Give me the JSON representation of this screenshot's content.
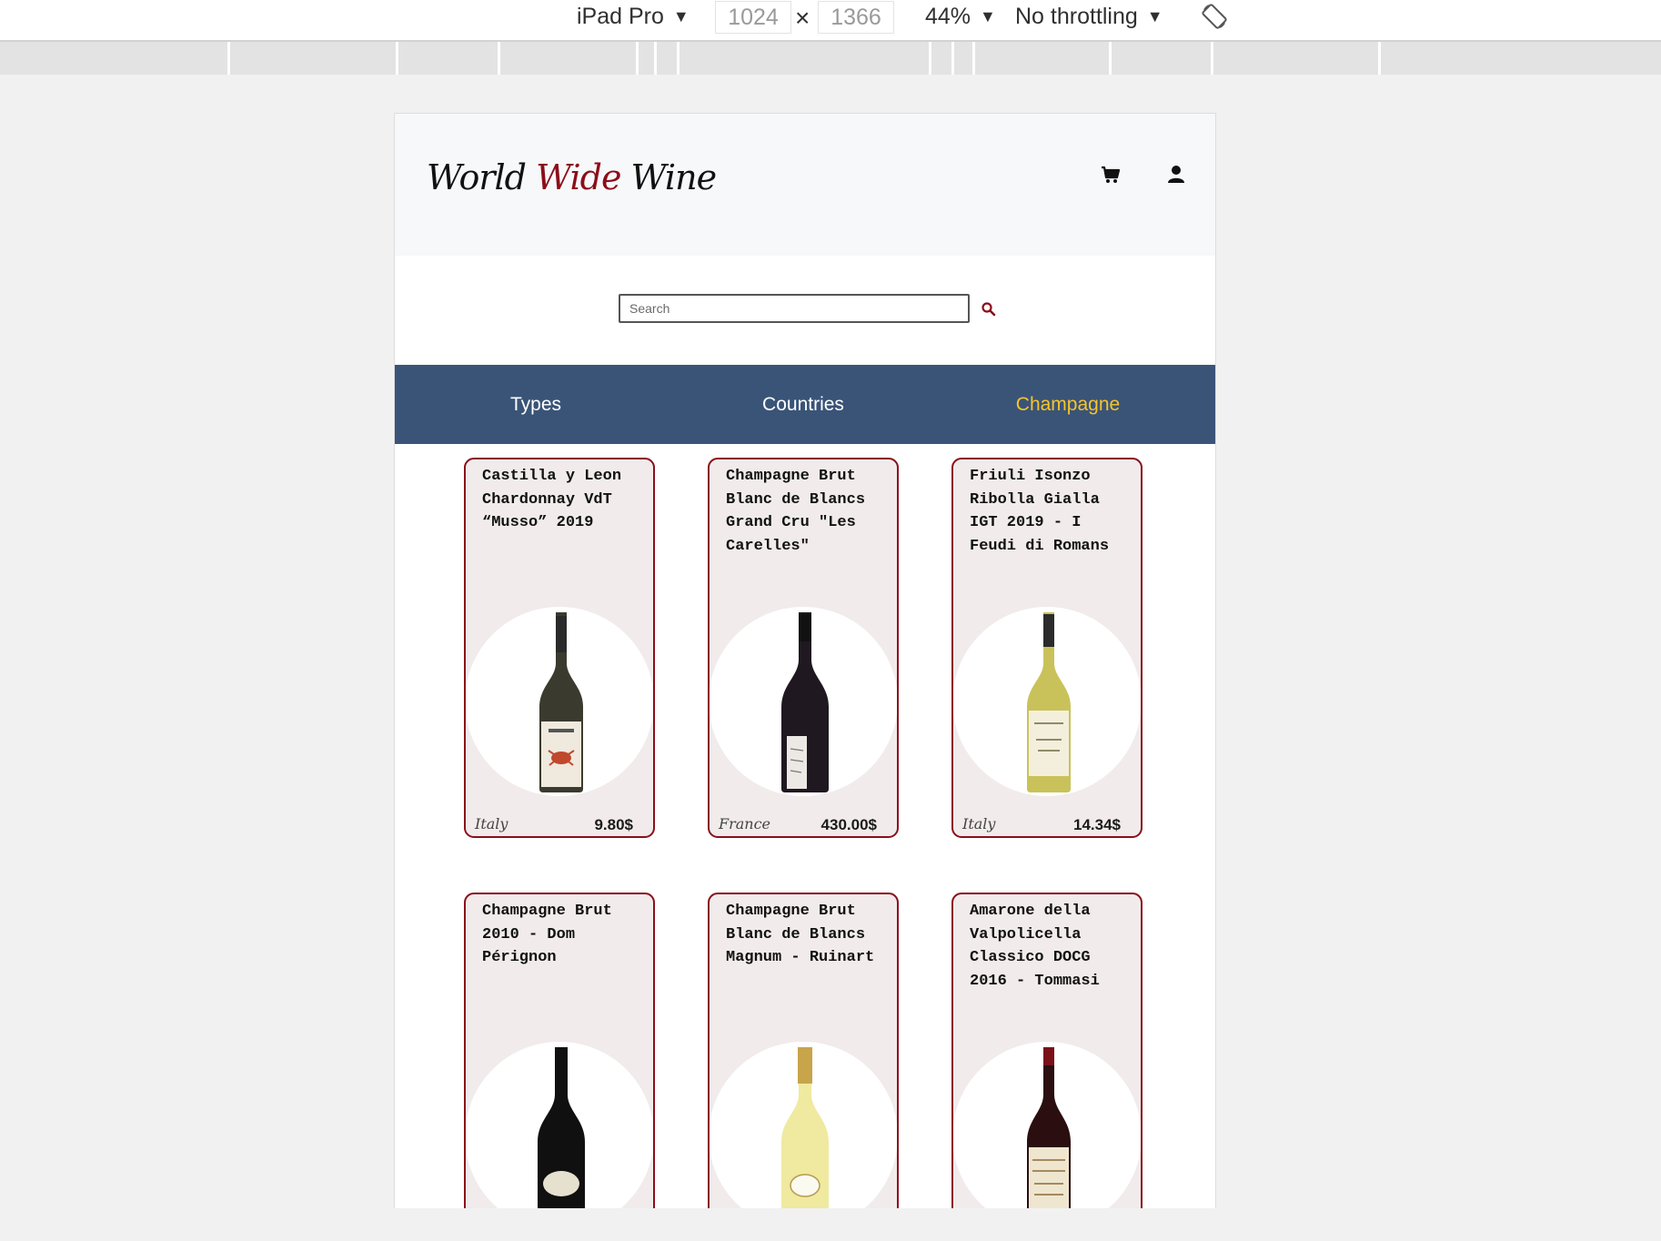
{
  "devtools": {
    "device": "iPad Pro",
    "width": "1024",
    "height": "1366",
    "times": "×",
    "zoom": "44%",
    "throttle": "No throttling",
    "caret": "▼"
  },
  "site": {
    "logo_part1": "World",
    "logo_part2": "Wide",
    "logo_part3": "Wine",
    "search_placeholder": "Search"
  },
  "nav": {
    "items": [
      {
        "label": "Types"
      },
      {
        "label": "Countries"
      },
      {
        "label": "Champagne",
        "active": true
      }
    ]
  },
  "colors": {
    "nav_bg": "#3a5478",
    "nav_active": "#f7c42b",
    "accent": "#8b0e1a",
    "card_bg": "#f1ebeb"
  },
  "products": [
    {
      "title": "Castilla y Leon Chardonnay VdT “Musso” 2019",
      "country": "Italy",
      "price": "9.80$",
      "bottle": "clear"
    },
    {
      "title": "Champagne Brut Blanc de Blancs Grand Cru \"Les Carelles\"",
      "country": "France",
      "price": "430.00$",
      "bottle": "dark"
    },
    {
      "title": "Friuli Isonzo Ribolla Gialla IGT 2019 - I Feudi di Romans",
      "country": "Italy",
      "price": "14.34$",
      "bottle": "white"
    },
    {
      "title": "Champagne Brut 2010 - Dom Pérignon",
      "country": "",
      "price": "",
      "bottle": "black"
    },
    {
      "title": "Champagne Brut Blanc de Blancs Magnum - Ruinart",
      "country": "",
      "price": "",
      "bottle": "gold"
    },
    {
      "title": "Amarone della Valpolicella Classico DOCG 2016 - Tommasi",
      "country": "",
      "price": "",
      "bottle": "red"
    }
  ]
}
